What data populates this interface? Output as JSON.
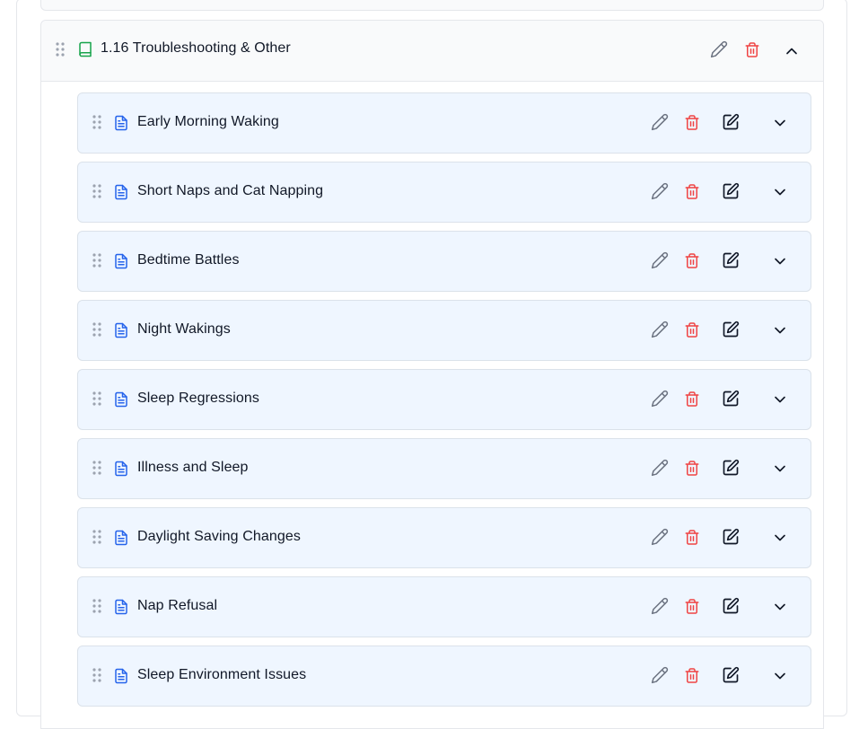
{
  "module": {
    "title": "1.16 Troubleshooting & Other",
    "expanded": true
  },
  "lessons": [
    {
      "title": "Early Morning Waking"
    },
    {
      "title": "Short Naps and Cat Napping"
    },
    {
      "title": "Bedtime Battles"
    },
    {
      "title": "Night Wakings"
    },
    {
      "title": "Sleep Regressions"
    },
    {
      "title": "Illness and Sleep"
    },
    {
      "title": "Daylight Saving Changes"
    },
    {
      "title": "Nap Refusal"
    },
    {
      "title": "Sleep Environment Issues"
    }
  ],
  "icons": {
    "drag": "drag-handle-icon",
    "module": "book-icon",
    "lesson": "document-icon",
    "rename": "pencil-icon",
    "delete": "trash-icon",
    "edit_content": "edit-square-icon",
    "collapse": "chevron-up-icon",
    "expand": "chevron-down-icon"
  },
  "colors": {
    "module_icon": "#16a34a",
    "lesson_icon": "#2563eb",
    "delete": "#ef4444",
    "rename": "#6b7280",
    "lesson_bg": "#eff6ff",
    "header_bg": "#f9fafb"
  }
}
